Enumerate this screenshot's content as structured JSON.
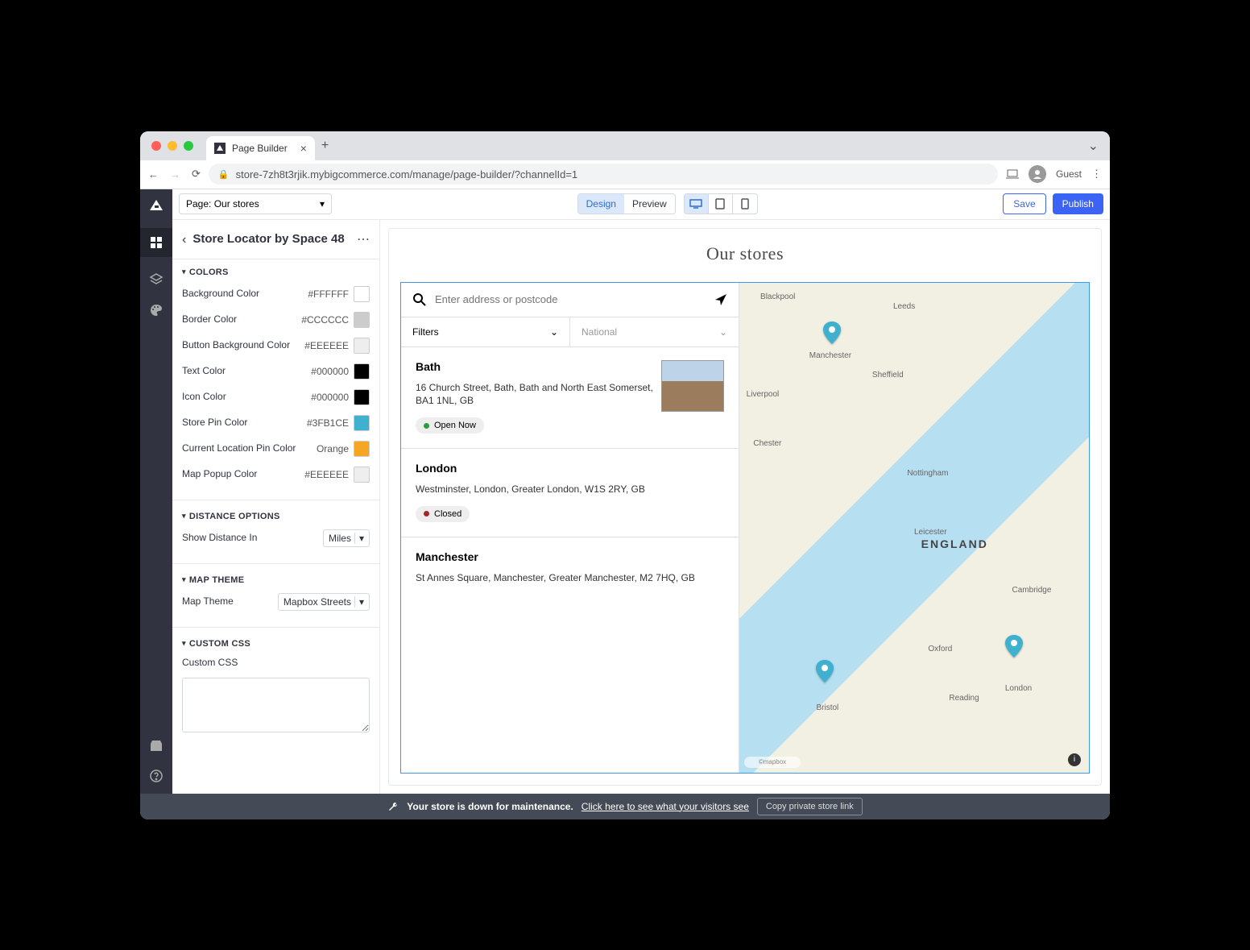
{
  "browser": {
    "tab_title": "Page Builder",
    "url": "store-7zh8t3rjik.mybigcommerce.com/manage/page-builder/?channelId=1",
    "profile": "Guest"
  },
  "toolbar": {
    "page_select": "Page: Our stores",
    "design": "Design",
    "preview": "Preview",
    "save": "Save",
    "publish": "Publish"
  },
  "sidebar": {
    "title": "Store Locator by Space 48",
    "sections": {
      "colors": {
        "title": "COLORS",
        "items": [
          {
            "label": "Background Color",
            "value": "#FFFFFF",
            "swatch": "#FFFFFF"
          },
          {
            "label": "Border Color",
            "value": "#CCCCCC",
            "swatch": "#CCCCCC"
          },
          {
            "label": "Button Background Color",
            "value": "#EEEEEE",
            "swatch": "#EEEEEE"
          },
          {
            "label": "Text Color",
            "value": "#000000",
            "swatch": "#000000"
          },
          {
            "label": "Icon Color",
            "value": "#000000",
            "swatch": "#000000"
          },
          {
            "label": "Store Pin Color",
            "value": "#3FB1CE",
            "swatch": "#3FB1CE"
          },
          {
            "label": "Current Location Pin Color",
            "value": "Orange",
            "swatch": "#f5a623"
          },
          {
            "label": "Map Popup Color",
            "value": "#EEEEEE",
            "swatch": "#EEEEEE"
          }
        ]
      },
      "distance": {
        "title": "DISTANCE OPTIONS",
        "label": "Show Distance In",
        "value": "Miles"
      },
      "map_theme": {
        "title": "MAP THEME",
        "label": "Map Theme",
        "value": "Mapbox Streets"
      },
      "custom_css": {
        "title": "CUSTOM CSS",
        "label": "Custom CSS"
      }
    }
  },
  "page": {
    "heading": "Our stores",
    "search_placeholder": "Enter address or postcode",
    "filters_label": "Filters",
    "national_label": "National",
    "stores": [
      {
        "name": "Bath",
        "address": "16 Church Street, Bath, Bath and North East Somerset, BA1 1NL, GB",
        "status": "Open Now",
        "status_color": "green",
        "thumb": true
      },
      {
        "name": "London",
        "address": "Westminster, London, Greater London, W1S 2RY, GB",
        "status": "Closed",
        "status_color": "red",
        "thumb": false
      },
      {
        "name": "Manchester",
        "address": "St Annes Square, Manchester, Greater Manchester, M2 7HQ, GB",
        "status": "",
        "status_color": "",
        "thumb": false
      }
    ],
    "map": {
      "england_label": "ENGLAND",
      "pin_color": "#3FB1CE",
      "attribution": "©mapbox"
    }
  },
  "footer": {
    "wrench_text": "Your store is down for maintenance.",
    "link": "Click here to see what your visitors see",
    "copy": "Copy private store link"
  }
}
